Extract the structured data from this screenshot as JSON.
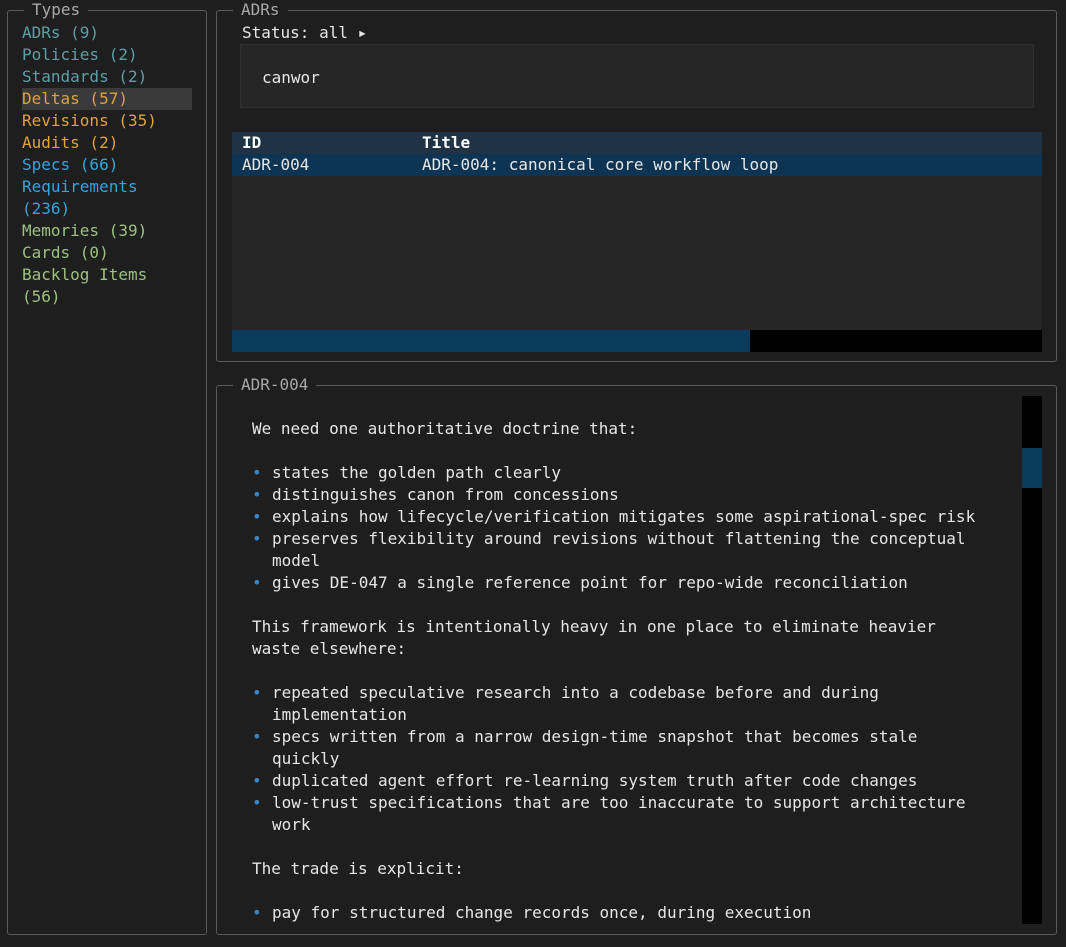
{
  "types_panel": {
    "title": "Types",
    "items": [
      {
        "label": "ADRs (9)",
        "color": "#5e9ea8"
      },
      {
        "label": "Policies (2)",
        "color": "#5e9ea8"
      },
      {
        "label": "Standards (2)",
        "color": "#5e9ea8"
      },
      {
        "label": "Deltas (57)",
        "color": "#e0a23c",
        "selected": true
      },
      {
        "label": "Revisions (35)",
        "color": "#e0a23c"
      },
      {
        "label": "Audits (2)",
        "color": "#e0a23c"
      },
      {
        "label": "Specs (66)",
        "color": "#2fa6dd"
      },
      {
        "label": "Requirements",
        "color": "#2fa6dd"
      },
      {
        "label": "(236)",
        "color": "#2fa6dd"
      },
      {
        "label": "Memories (39)",
        "color": "#9cc27f"
      },
      {
        "label": "Cards (0)",
        "color": "#9cc27f"
      },
      {
        "label": "Backlog Items",
        "color": "#9cc27f"
      },
      {
        "label": "(56)",
        "color": "#9cc27f"
      }
    ]
  },
  "adrs_panel": {
    "title": "ADRs",
    "status_label": "Status: all ▸",
    "search_value": "canwor",
    "columns": [
      "ID",
      "Title"
    ],
    "rows": [
      {
        "id": "ADR-004",
        "title": "ADR-004: canonical core workflow loop"
      }
    ],
    "scroll_progress": 0.64
  },
  "detail_panel": {
    "title": "ADR-004",
    "intro": "We need one authoritative doctrine that:",
    "bullets_1": [
      "states the golden path clearly",
      "distinguishes canon from concessions",
      "explains how lifecycle/verification mitigates some aspirational-spec risk",
      "preserves flexibility around revisions without flattening the conceptual",
      "model",
      "gives DE-047 a single reference point for repo-wide reconciliation"
    ],
    "para_2a": "This framework is intentionally heavy in one place to eliminate heavier",
    "para_2b": "waste elsewhere:",
    "bullets_2": [
      "repeated speculative research into a codebase before and during",
      "implementation",
      "specs written from a narrow design-time snapshot that becomes stale",
      "quickly",
      "duplicated agent effort re-learning system truth after code changes",
      "low-trust specifications that are too inaccurate to support architecture",
      "work"
    ],
    "para_3": "The trade is explicit:",
    "bullets_3": [
      "pay for structured change records once, during execution"
    ],
    "bullet_glyph": "•"
  },
  "colors": {
    "accent_blue": "#0a3a5c",
    "row_selected": "#0d3553",
    "header_bg": "#1a3a52"
  }
}
